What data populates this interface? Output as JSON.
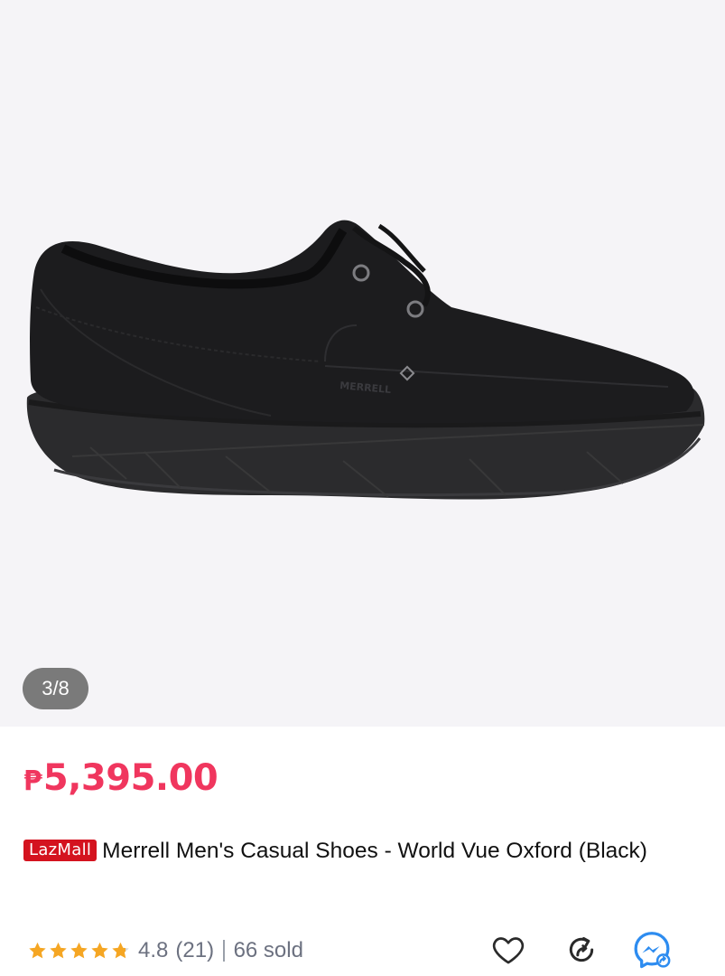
{
  "gallery": {
    "counter": "3/8",
    "brand_mark": "MERRELL"
  },
  "price": {
    "currency": "₱",
    "amount": "5,395.00"
  },
  "product": {
    "badge": "LazMall",
    "title": "Merrell Men's Casual Shoes - World Vue Oxford (Black)"
  },
  "rating": {
    "stars": 4.8,
    "score": "4.8",
    "reviews": "(21)",
    "sold": "66 sold"
  },
  "icons": {
    "star": "star-icon",
    "wishlist": "heart-icon",
    "share": "share-arrow-icon",
    "messenger": "messenger-icon"
  },
  "colors": {
    "price": "#f0365e",
    "badge": "#d4131f",
    "star": "#f5a623",
    "messenger": "#2d8cf0"
  }
}
